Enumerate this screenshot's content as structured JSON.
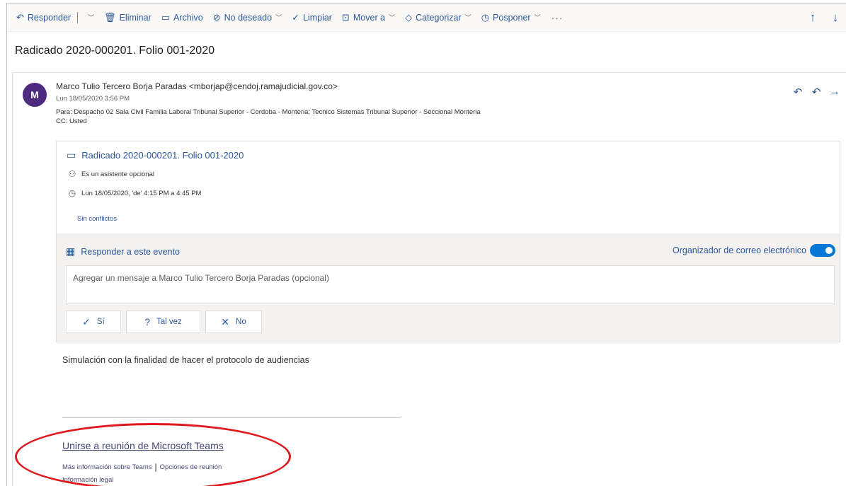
{
  "toolbar": {
    "reply": "Responder",
    "delete": "Eliminar",
    "archive": "Archivo",
    "junk": "No deseado",
    "sweep": "Limpiar",
    "move": "Mover a",
    "categorize": "Categorizar",
    "snooze": "Posponer",
    "more": "···"
  },
  "subject": "Radicado 2020-000201. Folio 001-2020",
  "message": {
    "avatar_initial": "M",
    "sender": "Marco Tulio Tercero Borja Paradas <mborjap@cendoj.ramajudicial.gov.co>",
    "date": "Lun 18/05/2020 3:56 PM",
    "to": "Para:  Despacho 02 Sala Civil Familia Laboral Tribunal Superior - Cordoba - Monteria; Tecnico Sistemas Tribunal Superior - Seccional Monteria",
    "cc": "CC:  Usted"
  },
  "invite": {
    "title": "Radicado 2020-000201. Folio 001-2020",
    "attendee": "Es un asistente opcional",
    "time": "Lun 18/05/2020, 'de' 4:15 PM a 4:45 PM",
    "conflicts": "Sin conflictos",
    "respond_title": "Responder a este evento",
    "organizer_label": "Organizador de correo electrónico",
    "message_placeholder": "Agregar un mensaje a Marco Tulio Tercero Borja Paradas (opcional)",
    "yes": "Sí",
    "maybe": "Tal vez",
    "no": "No"
  },
  "body": {
    "text": "Simulación con la finalidad de hacer el protocolo de audiencias",
    "teams_link": "Unirse a reunión de Microsoft Teams",
    "teams_info": "Más información sobre Teams",
    "meeting_options": "Opciones de reunión",
    "legal": "Información legal"
  },
  "colors": {
    "accent": "#2b579a",
    "avatar": "#4f2b80",
    "toggle": "#0078d4",
    "highlight": "#e0191f"
  }
}
